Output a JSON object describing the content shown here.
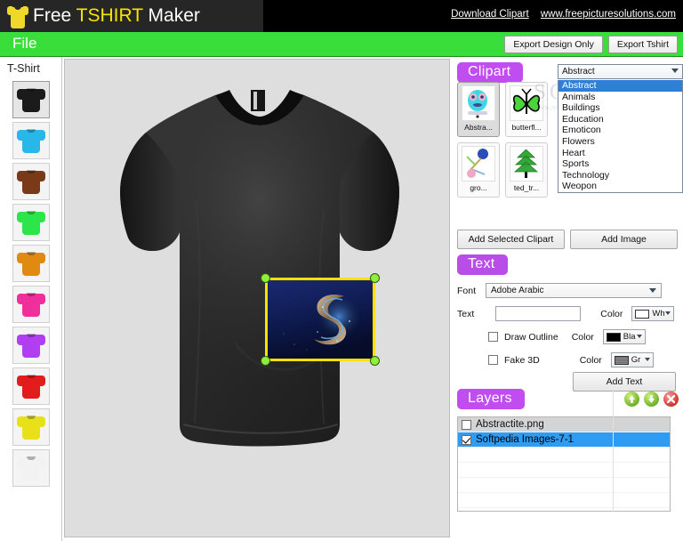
{
  "app": {
    "title_part1": "Free ",
    "title_highlight": "TSHIRT",
    "title_part2": " Maker",
    "logo_icon": "tshirt-icon",
    "links": [
      {
        "label": "Download Clipart",
        "name": "download-clipart-link"
      },
      {
        "label": "www.freepicturesolutions.com",
        "name": "website-link"
      }
    ]
  },
  "menubar": {
    "file_label": "File",
    "export_design_label": "Export Design Only",
    "export_tshirt_label": "Export Tshirt"
  },
  "sidebar": {
    "title": "T-Shirt",
    "swatches": [
      {
        "name": "tshirt-swatch-black",
        "color": "#1b1b1b",
        "selected": true
      },
      {
        "name": "tshirt-swatch-blue",
        "color": "#29b6e8",
        "selected": false
      },
      {
        "name": "tshirt-swatch-brown",
        "color": "#7b3a17",
        "selected": false
      },
      {
        "name": "tshirt-swatch-green",
        "color": "#2ce54a",
        "selected": false
      },
      {
        "name": "tshirt-swatch-orange",
        "color": "#e08a12",
        "selected": false
      },
      {
        "name": "tshirt-swatch-pink",
        "color": "#ef2f9a",
        "selected": false
      },
      {
        "name": "tshirt-swatch-purple",
        "color": "#b13ef0",
        "selected": false
      },
      {
        "name": "tshirt-swatch-red",
        "color": "#e21b1b",
        "selected": false
      },
      {
        "name": "tshirt-swatch-yellow",
        "color": "#e8e018",
        "selected": false
      },
      {
        "name": "tshirt-swatch-white",
        "color": "#f2f2f2",
        "selected": false
      }
    ]
  },
  "canvas": {
    "shirt_color": "#2a2a2a",
    "selection_border_color": "#ffe000",
    "handle_color": "#8ff03a",
    "design_description": "abstract blue swirl artwork"
  },
  "clipart": {
    "heading": "Clipart",
    "category_selected": "Abstract",
    "category_options": [
      "Abstract",
      "Animals",
      "Buildings",
      "Education",
      "Emoticon",
      "Flowers",
      "Heart",
      "Sports",
      "Technology",
      "Weopon"
    ],
    "dropdown_open": true,
    "items": [
      {
        "label": "Abstra...",
        "name": "clipart-item-abstract",
        "selected": true
      },
      {
        "label": "butterfl...",
        "name": "clipart-item-butterfly",
        "selected": false
      },
      {
        "label": "gro...",
        "name": "clipart-item-gro",
        "selected": false
      },
      {
        "label": "ted_tr...",
        "name": "clipart-item-ted-tree",
        "selected": false
      }
    ],
    "add_selected_label": "Add Selected Clipart",
    "add_image_label": "Add Image"
  },
  "watermark": {
    "main": "SOFTPEDIA",
    "sub": "www.softpedia.com"
  },
  "text_panel": {
    "heading": "Text",
    "font_label": "Font",
    "font_value": "Adobe Arabic",
    "text_label": "Text",
    "text_value": "",
    "color_label": "Color",
    "text_color": {
      "swatch": "#ffffff",
      "label": "Wh"
    },
    "draw_outline_label": "Draw Outline",
    "draw_outline_checked": false,
    "outline_color": {
      "swatch": "#000000",
      "label": "Bla"
    },
    "fake_3d_label": "Fake 3D",
    "fake_3d_checked": false,
    "fake3d_color": {
      "swatch": "#7a7a7a",
      "label": "Gr"
    },
    "add_text_label": "Add Text"
  },
  "layers": {
    "heading": "Layers",
    "move_up_icon": "arrow-up-icon",
    "move_down_icon": "arrow-down-icon",
    "delete_icon": "delete-x-icon",
    "rows": [
      {
        "label": "Abstractite.png",
        "checked": false,
        "selected": false
      },
      {
        "label": "Softpedia Images-7-1",
        "checked": true,
        "selected": true
      }
    ]
  }
}
